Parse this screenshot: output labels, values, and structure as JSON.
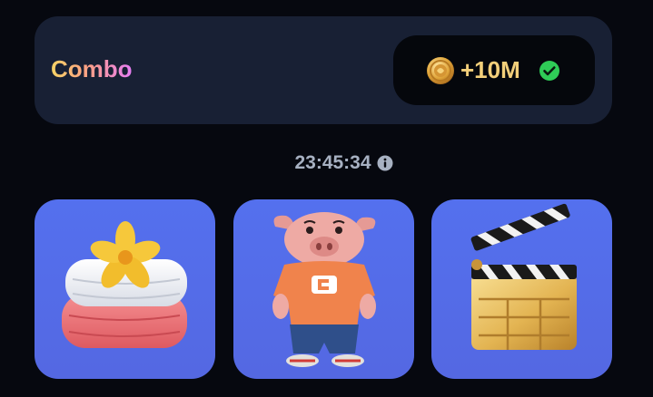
{
  "combo": {
    "title": "Combo",
    "reward": {
      "icon": "coin-icon",
      "amount": "+10M",
      "status_icon": "checkmark-circle-icon",
      "status_color": "#2fcc57"
    }
  },
  "timer": {
    "value": "23:45:34",
    "icon": "info-icon"
  },
  "cards": [
    {
      "name": "towels-with-flower"
    },
    {
      "name": "pig-character"
    },
    {
      "name": "film-clapperboard"
    }
  ],
  "colors": {
    "background": "#06080f",
    "panel": "#182034",
    "card": "#5470ee",
    "coin_gold": "#f3cf7a"
  }
}
